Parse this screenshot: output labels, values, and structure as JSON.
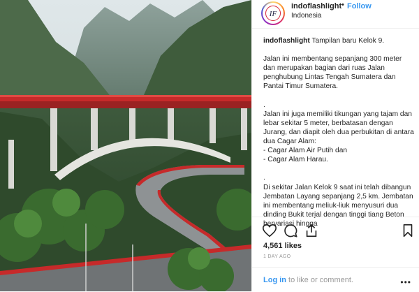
{
  "post": {
    "username": "indoflashlight",
    "separator": "•",
    "follow_label": "Follow",
    "location": "Indonesia",
    "caption_user": "indoflashlight",
    "caption_title": "Tampilan baru Kelok 9.",
    "paragraphs": [
      "Jalan ini membentang sepanjang 300 meter dan merupakan bagian dari ruas Jalan penghubung Lintas Tengah Sumatera dan Pantai Timur Sumatera.",
      ".\nJalan ini juga memiliki tikungan yang tajam dan lebar sekitar 5 meter, berbatasan dengan Jurang, dan diapit oleh dua perbukitan di antara dua Cagar Alam:\n- Cagar Alam Air Putih dan\n- Cagar Alam Harau.",
      ".\nDi sekitar Jalan Kelok 9 saat ini telah dibangun Jembatan Layang sepanjang 2,5 km. Jembatan ini membentang meliuk-liuk menyusuri dua dinding Bukit terjal dengan tinggi tiang Beton bervariasi hingga"
    ],
    "likes": "4,561 likes",
    "date": "1 DAY AGO",
    "login_link": "Log in",
    "login_rest": " to like or comment.",
    "more": "•••"
  },
  "icons": {
    "like": "heart-icon",
    "comment": "comment-icon",
    "share": "share-icon",
    "save": "bookmark-icon"
  },
  "colors": {
    "link": "#3897f0",
    "bridge": "#c62a2a",
    "muted": "#999999"
  }
}
